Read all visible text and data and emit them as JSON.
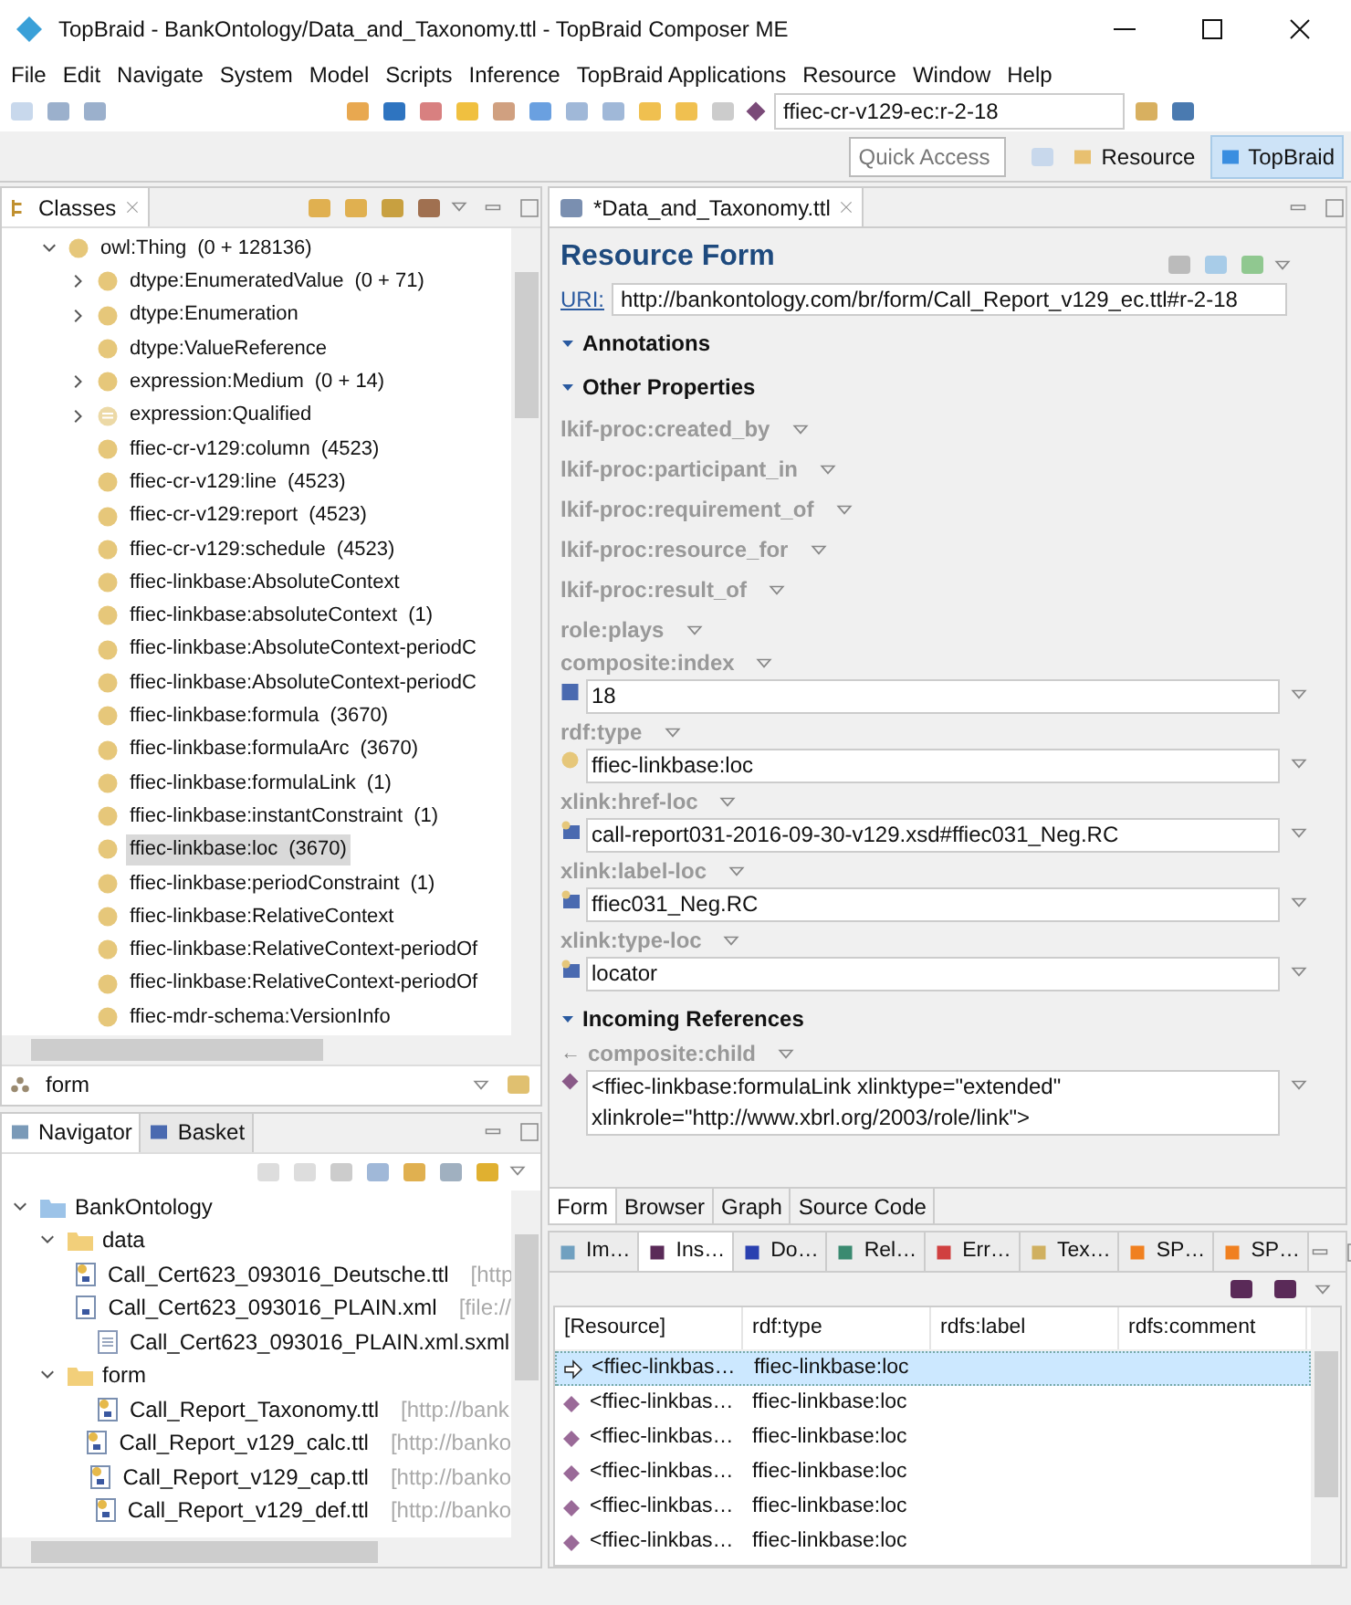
{
  "window": {
    "title": "TopBraid - BankOntology/Data_and_Taxonomy.ttl - TopBraid Composer ME"
  },
  "menu": [
    "File",
    "Edit",
    "Navigate",
    "System",
    "Model",
    "Scripts",
    "Inference",
    "TopBraid Applications",
    "Resource",
    "Window",
    "Help"
  ],
  "toolbar": {
    "resource_field": {
      "value": "ffiec-cr-v129-ec:r-2-18"
    },
    "quick_access": {
      "placeholder": "Quick Access"
    },
    "perspectives": [
      {
        "label": "Resource",
        "selected": false
      },
      {
        "label": "TopBraid",
        "selected": true
      }
    ]
  },
  "classes": {
    "title": "Classes",
    "filter": {
      "value": "form"
    },
    "tree": [
      {
        "label": "owl:Thing",
        "count": "(0 + 128136)",
        "kind": "class",
        "selected": false,
        "expanded": true,
        "children": [
          {
            "label": "dtype:EnumeratedValue",
            "count": "(0 + 71)",
            "kind": "class",
            "selected": false,
            "expanded": false
          },
          {
            "label": "dtype:Enumeration",
            "kind": "class",
            "selected": false,
            "expanded": false
          },
          {
            "label": "dtype:ValueReference",
            "kind": "class",
            "selected": false
          },
          {
            "label": "expression:Medium",
            "count": "(0 + 14)",
            "kind": "class",
            "selected": false,
            "expanded": false
          },
          {
            "label": "expression:Qualified",
            "kind": "restriction",
            "selected": false,
            "expanded": false
          },
          {
            "label": "ffiec-cr-v129:column",
            "count": "(4523)",
            "kind": "class",
            "selected": false
          },
          {
            "label": "ffiec-cr-v129:line",
            "count": "(4523)",
            "kind": "class",
            "selected": false
          },
          {
            "label": "ffiec-cr-v129:report",
            "count": "(4523)",
            "kind": "class",
            "selected": false
          },
          {
            "label": "ffiec-cr-v129:schedule",
            "count": "(4523)",
            "kind": "class",
            "selected": false
          },
          {
            "label": "ffiec-linkbase:AbsoluteContext",
            "kind": "class",
            "selected": false
          },
          {
            "label": "ffiec-linkbase:absoluteContext",
            "count": "(1)",
            "kind": "class",
            "selected": false
          },
          {
            "label": "ffiec-linkbase:AbsoluteContext-periodC",
            "kind": "class",
            "selected": false
          },
          {
            "label": "ffiec-linkbase:AbsoluteContext-periodC",
            "kind": "class",
            "selected": false
          },
          {
            "label": "ffiec-linkbase:formula",
            "count": "(3670)",
            "kind": "class",
            "selected": false
          },
          {
            "label": "ffiec-linkbase:formulaArc",
            "count": "(3670)",
            "kind": "class",
            "selected": false
          },
          {
            "label": "ffiec-linkbase:formulaLink",
            "count": "(1)",
            "kind": "class",
            "selected": false
          },
          {
            "label": "ffiec-linkbase:instantConstraint",
            "count": "(1)",
            "kind": "class",
            "selected": false
          },
          {
            "label": "ffiec-linkbase:loc",
            "count": "(3670)",
            "kind": "class",
            "selected": true
          },
          {
            "label": "ffiec-linkbase:periodConstraint",
            "count": "(1)",
            "kind": "class",
            "selected": false
          },
          {
            "label": "ffiec-linkbase:RelativeContext",
            "kind": "class",
            "selected": false
          },
          {
            "label": "ffiec-linkbase:RelativeContext-periodOf",
            "kind": "class",
            "selected": false
          },
          {
            "label": "ffiec-linkbase:RelativeContext-periodOf",
            "kind": "class",
            "selected": false
          },
          {
            "label": "ffiec-mdr-schema:VersionInfo",
            "kind": "class",
            "selected": false
          }
        ]
      }
    ]
  },
  "navigator": {
    "tabs": [
      {
        "label": "Navigator",
        "selected": true
      },
      {
        "label": "Basket",
        "selected": false
      }
    ],
    "tree": [
      {
        "label": "BankOntology",
        "kind": "project",
        "expanded": true,
        "children": [
          {
            "label": "data",
            "kind": "folder",
            "expanded": true,
            "children": [
              {
                "label": "Call_Cert623_093016_Deutsche.ttl",
                "location": "[http",
                "kind": "ontology"
              },
              {
                "label": "Call_Cert623_093016_PLAIN.xml",
                "location": "[file://",
                "kind": "xml"
              },
              {
                "label": "Call_Cert623_093016_PLAIN.xml.sxml",
                "kind": "text"
              }
            ]
          },
          {
            "label": "form",
            "kind": "folder",
            "expanded": true,
            "children": [
              {
                "label": "Call_Report_Taxonomy.ttl",
                "location": "[http://bank",
                "kind": "ontology"
              },
              {
                "label": "Call_Report_v129_calc.ttl",
                "location": "[http://banko",
                "kind": "ontology"
              },
              {
                "label": "Call_Report_v129_cap.ttl",
                "location": "[http://banko",
                "kind": "ontology"
              },
              {
                "label": "Call_Report_v129_def.ttl",
                "location": "[http://banko",
                "kind": "ontology"
              }
            ]
          }
        ]
      }
    ]
  },
  "editor": {
    "tab": "*Data_and_Taxonomy.ttl",
    "heading": "Resource Form",
    "uri_label": "URI:",
    "uri": "http://bankontology.com/br/form/Call_Report_v129_ec.ttl#r-2-18",
    "sections": [
      {
        "title": "Annotations",
        "expanded": true
      },
      {
        "title": "Other Properties",
        "expanded": true,
        "properties": [
          {
            "name": "lkif-proc:created_by"
          },
          {
            "name": "lkif-proc:participant_in"
          },
          {
            "name": "lkif-proc:requirement_of"
          },
          {
            "name": "lkif-proc:resource_for"
          },
          {
            "name": "lkif-proc:result_of"
          },
          {
            "name": "role:plays"
          },
          {
            "name": "composite:index",
            "value": "18",
            "kind": "integer"
          },
          {
            "name": "rdf:type",
            "value": "ffiec-linkbase:loc",
            "kind": "class"
          },
          {
            "name": "xlink:href-loc",
            "value": "call-report031-2016-09-30-v129.xsd#ffiec031_Neg.RC",
            "kind": "string"
          },
          {
            "name": "xlink:label-loc",
            "value": "ffiec031_Neg.RC",
            "kind": "string"
          },
          {
            "name": "xlink:type-loc",
            "value": "locator",
            "kind": "string"
          }
        ]
      },
      {
        "title": "Incoming References",
        "expanded": true,
        "properties": [
          {
            "name": "composite:child",
            "value": "<ffiec-linkbase:formulaLink xlinktype=\"extended\" xlinkrole=\"http://www.xbrl.org/2003/role/link\">",
            "kind": "instance",
            "arrow": "←"
          }
        ]
      }
    ],
    "tabs": [
      {
        "label": "Form",
        "selected": true
      },
      {
        "label": "Browser",
        "selected": false
      },
      {
        "label": "Graph",
        "selected": false
      },
      {
        "label": "Source Code",
        "selected": false
      }
    ]
  },
  "instances": {
    "tabs": [
      {
        "label": "Im…",
        "selected": false
      },
      {
        "label": "Ins…",
        "selected": true
      },
      {
        "label": "Do…",
        "selected": false
      },
      {
        "label": "Rel…",
        "selected": false
      },
      {
        "label": "Err…",
        "selected": false
      },
      {
        "label": "Tex…",
        "selected": false
      },
      {
        "label": "SP…",
        "selected": false
      },
      {
        "label": "SP…",
        "selected": false
      }
    ],
    "columns": [
      "[Resource]",
      "rdf:type",
      "rdfs:label",
      "rdfs:comment"
    ],
    "rows": [
      {
        "resource": "<ffiec-linkbas…",
        "type": "ffiec-linkbase:loc",
        "selected": true
      },
      {
        "resource": "<ffiec-linkbas…",
        "type": "ffiec-linkbase:loc",
        "selected": false
      },
      {
        "resource": "<ffiec-linkbas…",
        "type": "ffiec-linkbase:loc",
        "selected": false
      },
      {
        "resource": "<ffiec-linkbas…",
        "type": "ffiec-linkbase:loc",
        "selected": false
      },
      {
        "resource": "<ffiec-linkbas…",
        "type": "ffiec-linkbase:loc",
        "selected": false
      },
      {
        "resource": "<ffiec-linkbas…",
        "type": "ffiec-linkbase:loc",
        "selected": false
      }
    ]
  }
}
